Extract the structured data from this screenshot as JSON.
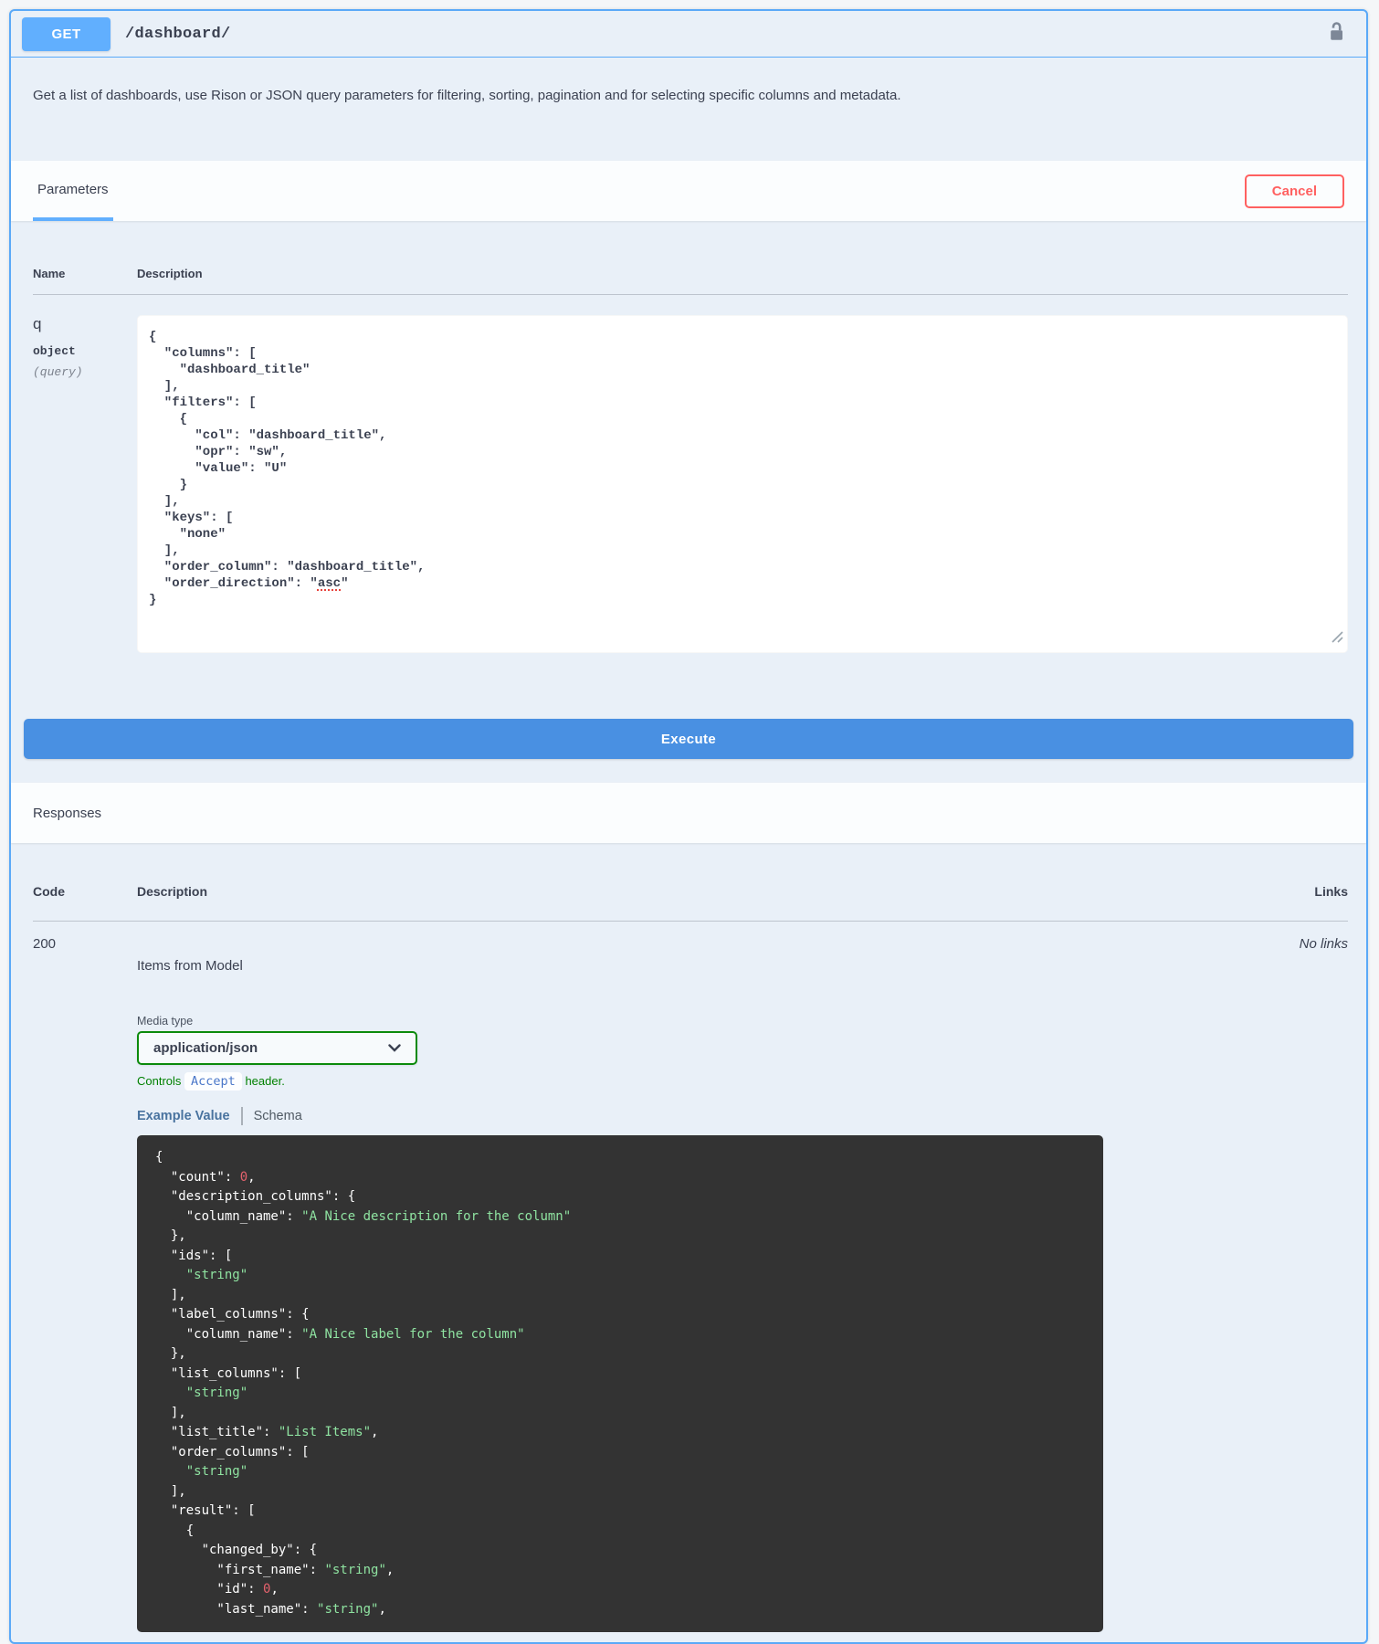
{
  "opblock": {
    "method": "GET",
    "path": "/dashboard/",
    "description": "Get a list of dashboards, use Rison or JSON query parameters for filtering, sorting, pagination and for selecting specific columns and metadata."
  },
  "parameters": {
    "tab_label": "Parameters",
    "cancel_label": "Cancel",
    "columns": {
      "name": "Name",
      "description": "Description"
    },
    "param": {
      "name": "q",
      "type": "object",
      "location": "(query)",
      "misspelled_word": "asc",
      "value_lines": [
        "{",
        "  \"columns\": [",
        "    \"dashboard_title\"",
        "  ],",
        "  \"filters\": [",
        "    {",
        "      \"col\": \"dashboard_title\",",
        "      \"opr\": \"sw\",",
        "      \"value\": \"U\"",
        "    }",
        "  ],",
        "  \"keys\": [",
        "    \"none\"",
        "  ],",
        "  \"order_column\": \"dashboard_title\",",
        "  \"order_direction\": \"asc\"",
        "}"
      ]
    },
    "execute_label": "Execute"
  },
  "responses": {
    "title": "Responses",
    "columns": {
      "code": "Code",
      "description": "Description",
      "links": "Links"
    },
    "response": {
      "code": "200",
      "description": "Items from Model",
      "links": "No links",
      "media_type": {
        "label": "Media type",
        "selected": "application/json",
        "controls_prefix": "Controls",
        "controls_code": "Accept",
        "controls_suffix": "header."
      },
      "tabs": {
        "example": "Example Value",
        "schema": "Schema"
      },
      "example_lines": [
        "{",
        "  \"count\": 0,",
        "  \"description_columns\": {",
        "    \"column_name\": \"A Nice description for the column\"",
        "  },",
        "  \"ids\": [",
        "    \"string\"",
        "  ],",
        "  \"label_columns\": {",
        "    \"column_name\": \"A Nice label for the column\"",
        "  },",
        "  \"list_columns\": [",
        "    \"string\"",
        "  ],",
        "  \"list_title\": \"List Items\",",
        "  \"order_columns\": [",
        "    \"string\"",
        "  ],",
        "  \"result\": [",
        "    {",
        "      \"changed_by\": {",
        "        \"first_name\": \"string\",",
        "        \"id\": 0,",
        "        \"last_name\": \"string\","
      ]
    }
  },
  "colors": {
    "method_blue": "#61affe",
    "panel_bg": "#e9f0f8",
    "execute_blue": "#4990e2",
    "cancel_red": "#ff6060",
    "media_green": "#008000",
    "code_bg": "#333333",
    "code_string_green": "#8fe3a1",
    "code_number_red": "#e5626d"
  }
}
